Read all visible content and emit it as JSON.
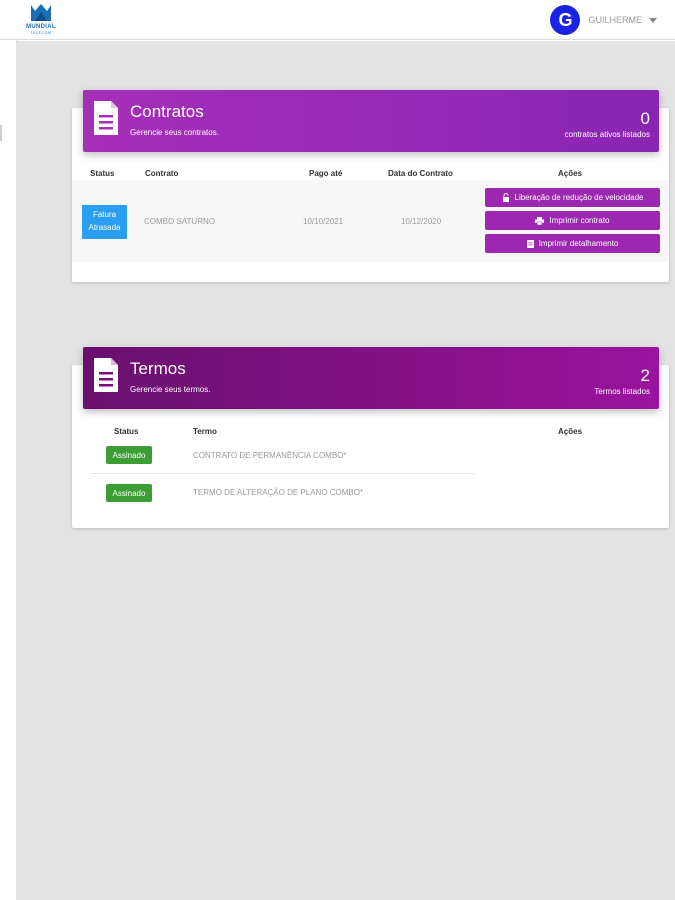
{
  "header": {
    "logo_text": "MUNDIAL",
    "logo_sub": "TELECOM",
    "user_initial": "G",
    "user_name": "GUILHERME"
  },
  "colors": {
    "contracts_header": "#a62fb8",
    "terms_header": "#8a1290",
    "action_button": "#9c27b0",
    "status_overdue": "#2a9ef0",
    "status_signed": "#3c9d32",
    "avatar": "#1a22e6"
  },
  "contracts": {
    "title": "Contratos",
    "subtitle": "Gerencie seus contratos.",
    "count": "0",
    "count_label": "contratos ativos listados",
    "icon": "document-icon",
    "columns": [
      "Status",
      "Contrato",
      "Pago até",
      "Data do Contrato",
      "Ações"
    ],
    "rows": [
      {
        "status_line1": "Fatura",
        "status_line2": "Atrasada",
        "contract": "COMBO SATURNO",
        "paid_until": "10/10/2021",
        "contract_date": "10/12/2020",
        "actions": [
          {
            "label": "Liberação de redução de velocidade",
            "icon": "unlock-icon"
          },
          {
            "label": "Imprimir contrato",
            "icon": "print-icon"
          },
          {
            "label": "Imprimir detalhamento",
            "icon": "file-icon"
          }
        ]
      }
    ]
  },
  "terms": {
    "title": "Termos",
    "subtitle": "Gerencie seus termos.",
    "count": "2",
    "count_label": "Termos listados",
    "icon": "document-icon",
    "columns": [
      "Status",
      "Termo",
      "Ações"
    ],
    "rows": [
      {
        "status": "Assinado",
        "term": "CONTRATO DE PERMANÊNCIA COMBO*"
      },
      {
        "status": "Assinado",
        "term": "TERMO DE ALTERAÇÃO DE PLANO COMBO*"
      }
    ]
  }
}
